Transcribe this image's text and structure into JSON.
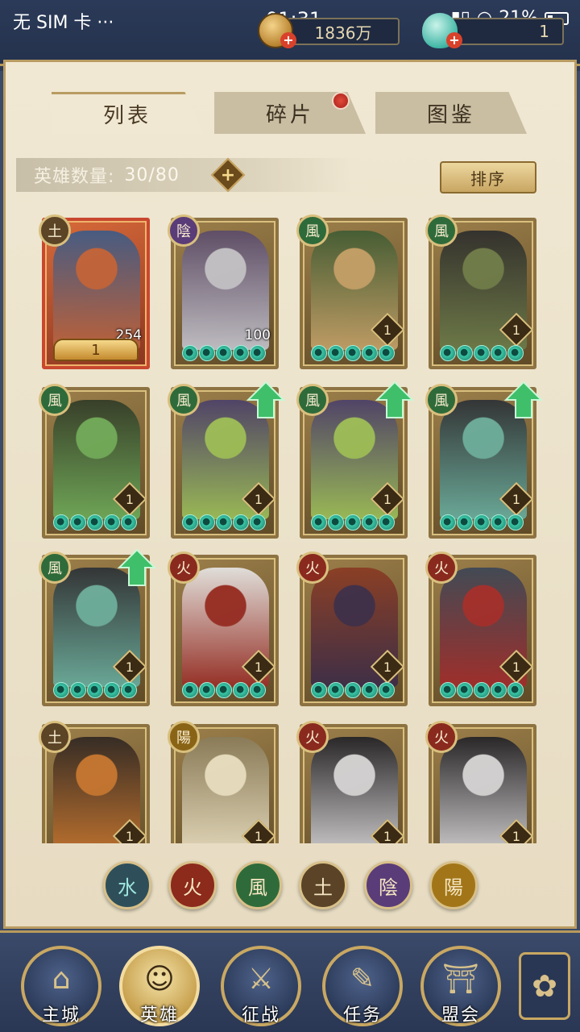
{
  "status_bar": {
    "carrier": "无 SIM 卡 ···",
    "time": "01:31",
    "battery": "21%"
  },
  "resources": {
    "coins": "1836万",
    "jade": "1"
  },
  "tabs": [
    {
      "label": "列表",
      "active": true
    },
    {
      "label": "碎片",
      "active": false,
      "has_notification": true
    },
    {
      "label": "图鉴",
      "active": false
    }
  ],
  "hero_count": {
    "label": "英雄数量:",
    "value": "30/80"
  },
  "sort_button": "排序",
  "element_glyphs": {
    "earth": "土",
    "yin": "陰",
    "wind": "風",
    "fire": "火",
    "yang": "陽",
    "water": "水"
  },
  "heroes": [
    {
      "element": "earth",
      "stars": 0,
      "level": "1",
      "count": "254",
      "special_crown": true,
      "upgrade": false,
      "colors": [
        "#3a5b8a",
        "#c0653c"
      ]
    },
    {
      "element": "yin",
      "stars": 5,
      "level": "",
      "count": "100",
      "special_crown": false,
      "upgrade": false,
      "colors": [
        "#5a4a6a",
        "#c7c7d0"
      ]
    },
    {
      "element": "wind",
      "stars": 5,
      "level": "1",
      "count": "",
      "special_crown": false,
      "upgrade": false,
      "colors": [
        "#3f5b33",
        "#c7a36a"
      ]
    },
    {
      "element": "wind",
      "stars": 5,
      "level": "1",
      "count": "",
      "special_crown": false,
      "upgrade": false,
      "colors": [
        "#2b2b2b",
        "#6d7d4a"
      ]
    },
    {
      "element": "wind",
      "stars": 5,
      "level": "1",
      "count": "",
      "special_crown": false,
      "upgrade": false,
      "colors": [
        "#2f3a27",
        "#6fae5b"
      ]
    },
    {
      "element": "wind",
      "stars": 5,
      "level": "1",
      "count": "",
      "special_crown": false,
      "upgrade": true,
      "colors": [
        "#4a3f6b",
        "#9ec35a"
      ]
    },
    {
      "element": "wind",
      "stars": 5,
      "level": "1",
      "count": "",
      "special_crown": false,
      "upgrade": true,
      "colors": [
        "#4a3f6b",
        "#9ec35a"
      ]
    },
    {
      "element": "wind",
      "stars": 5,
      "level": "1",
      "count": "",
      "special_crown": false,
      "upgrade": true,
      "colors": [
        "#2a2f35",
        "#6ab1a2"
      ]
    },
    {
      "element": "wind",
      "stars": 5,
      "level": "1",
      "count": "",
      "special_crown": false,
      "upgrade": true,
      "colors": [
        "#2a2f35",
        "#6ab1a2"
      ]
    },
    {
      "element": "fire",
      "stars": 5,
      "level": "1",
      "count": "",
      "special_crown": false,
      "upgrade": false,
      "colors": [
        "#e9e9e9",
        "#9a2c25"
      ]
    },
    {
      "element": "fire",
      "stars": 5,
      "level": "1",
      "count": "",
      "special_crown": false,
      "upgrade": false,
      "colors": [
        "#8a3a22",
        "#3a2b4a"
      ]
    },
    {
      "element": "fire",
      "stars": 5,
      "level": "1",
      "count": "",
      "special_crown": false,
      "upgrade": false,
      "colors": [
        "#3a4656",
        "#a52b2b"
      ]
    },
    {
      "element": "earth",
      "stars": 0,
      "level": "1",
      "count": "",
      "special_crown": false,
      "upgrade": false,
      "colors": [
        "#2d2522",
        "#c9762f"
      ]
    },
    {
      "element": "yang",
      "stars": 0,
      "level": "1",
      "count": "",
      "special_crown": false,
      "upgrade": false,
      "colors": [
        "#8a7c5a",
        "#efe6c9"
      ]
    },
    {
      "element": "fire",
      "stars": 0,
      "level": "1",
      "count": "",
      "special_crown": false,
      "upgrade": false,
      "colors": [
        "#1f1f26",
        "#d9d9de"
      ]
    },
    {
      "element": "fire",
      "stars": 0,
      "level": "1",
      "count": "",
      "special_crown": false,
      "upgrade": false,
      "colors": [
        "#1f1f26",
        "#d9d9de"
      ]
    }
  ],
  "filters": [
    {
      "key": "water",
      "glyph": "水"
    },
    {
      "key": "fire",
      "glyph": "火"
    },
    {
      "key": "wind",
      "glyph": "風"
    },
    {
      "key": "earth",
      "glyph": "土"
    },
    {
      "key": "yin",
      "glyph": "陰"
    },
    {
      "key": "yang",
      "glyph": "陽"
    }
  ],
  "nav": [
    {
      "label": "主城",
      "icon": "city-icon",
      "glyph": "⌂",
      "active": false
    },
    {
      "label": "英雄",
      "icon": "hero-icon",
      "glyph": "☺",
      "active": true
    },
    {
      "label": "征战",
      "icon": "battle-icon",
      "glyph": "⚔",
      "active": false
    },
    {
      "label": "任务",
      "icon": "quest-icon",
      "glyph": "✎",
      "active": false
    },
    {
      "label": "盟会",
      "icon": "guild-icon",
      "glyph": "⛩",
      "active": false
    }
  ],
  "menu_glyph": "✿"
}
